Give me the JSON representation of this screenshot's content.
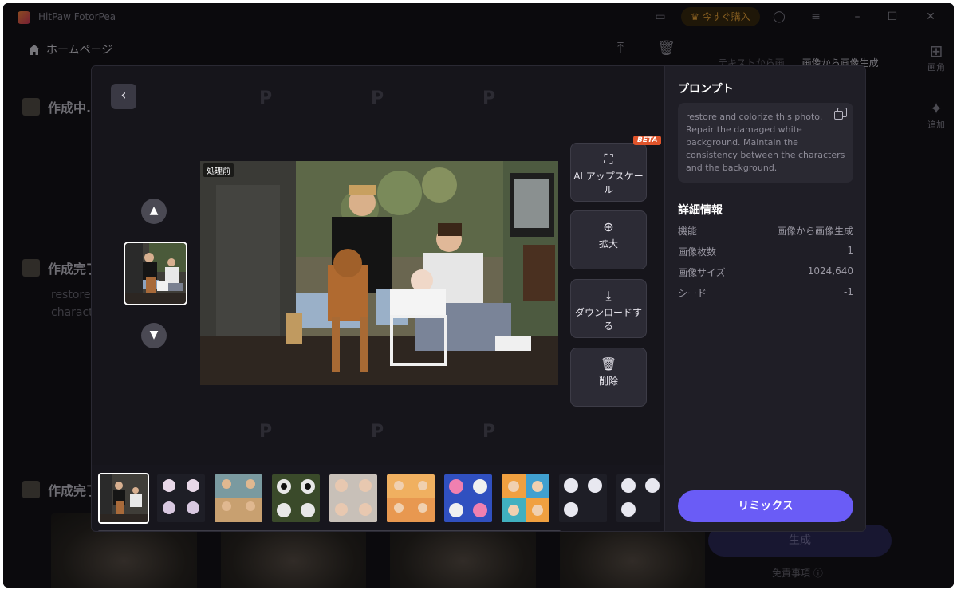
{
  "app": {
    "title": "HitPaw FotorPea",
    "buy_label": "今すぐ購入"
  },
  "background": {
    "home_label": "ホームページ",
    "tabs": [
      "テキストから画",
      "画像から画像生成"
    ],
    "side_items": [
      {
        "label": "画角",
        "icon": "grid-icon"
      },
      {
        "label": "追加",
        "icon": "sparkle-icon"
      }
    ],
    "rows": [
      {
        "label": "作成中..."
      },
      {
        "label": "作成完了"
      },
      {
        "label": "作成完了"
      }
    ],
    "row_text_1": "restore",
    "row_text_2": "characte",
    "generate_label": "生成",
    "disclaimer_label": "免責事項",
    "badge_count": "1"
  },
  "modal": {
    "before_label": "処理前",
    "actions": [
      {
        "label": "AI アップスケール",
        "icon": "upscale-icon",
        "badge": "BETA"
      },
      {
        "label": "拡大",
        "icon": "zoom-in-icon"
      },
      {
        "label": "ダウンロードする",
        "icon": "download-icon"
      },
      {
        "label": "削除",
        "icon": "trash-icon"
      }
    ],
    "strip_count": 10
  },
  "panel": {
    "prompt_title": "プロンプト",
    "prompt_text": "restore and colorize this photo. Repair the damaged white background. Maintain the consistency between the characters and the background.",
    "details_title": "詳細情報",
    "details": [
      {
        "label": "機能",
        "value": "画像から画像生成"
      },
      {
        "label": "画像枚数",
        "value": "1"
      },
      {
        "label": "画像サイズ",
        "value": "1024,640"
      },
      {
        "label": "シード",
        "value": "-1"
      }
    ],
    "remix_label": "リミックス"
  },
  "colors": {
    "accent": "#6a5cf6",
    "beta": "#e0542b",
    "buy": "#f0a83a"
  }
}
